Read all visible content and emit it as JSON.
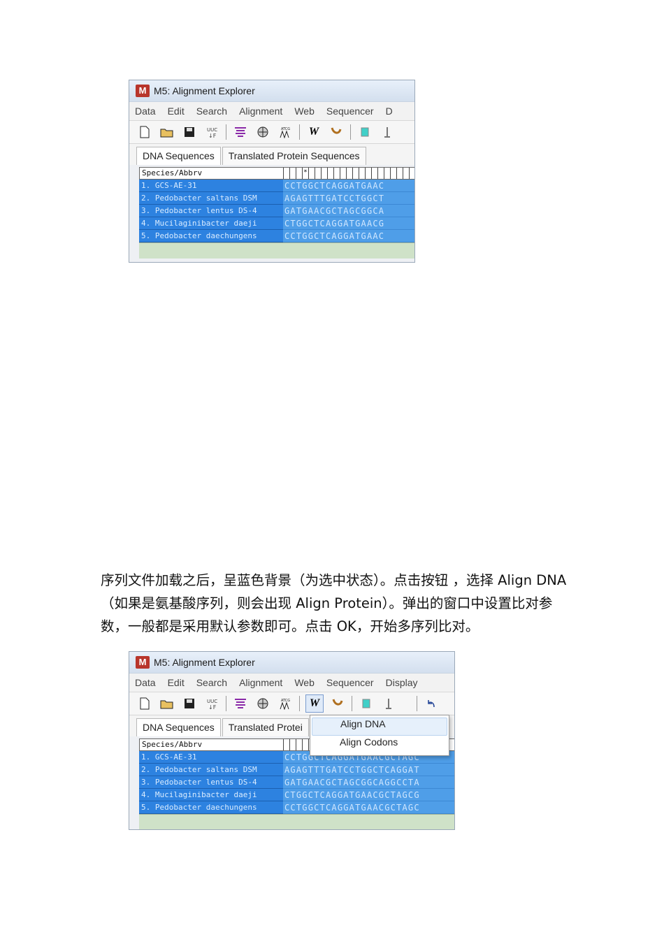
{
  "window1": {
    "title": "M5: Alignment Explorer",
    "menu": [
      "Data",
      "Edit",
      "Search",
      "Alignment",
      "Web",
      "Sequencer",
      "D"
    ],
    "tabs": [
      "DNA Sequences",
      "Translated Protein Sequences"
    ],
    "grid": {
      "header": "Species/Abbrv",
      "header_marker": "*",
      "rows": [
        {
          "name": "1. GCS-AE-31",
          "seq": "CCTGGCTCAGGATGAAC"
        },
        {
          "name": "2. Pedobacter saltans DSM",
          "seq": "AGAGTTTGATCCTGGCT"
        },
        {
          "name": "3. Pedobacter lentus DS-4",
          "seq": "GATGAACGCTAGCGGCA"
        },
        {
          "name": "4. Mucilaginibacter daeji",
          "seq": "CTGGCTCAGGATGAACG"
        },
        {
          "name": "5. Pedobacter daechungens",
          "seq": "CCTGGCTCAGGATGAAC"
        }
      ]
    }
  },
  "paragraph": "序列文件加载之后，呈蓝色背景（为选中状态）。点击按钮 ，选择 Align DNA（如果是氨基酸序列，则会出现 Align Protein）。弹出的窗口中设置比对参数，一般都是采用默认参数即可。点击 OK，开始多序列比对。",
  "window2": {
    "title": "M5: Alignment Explorer",
    "menu": [
      "Data",
      "Edit",
      "Search",
      "Alignment",
      "Web",
      "Sequencer",
      "Display"
    ],
    "tabs": [
      "DNA Sequences",
      "Translated Protei"
    ],
    "popup": [
      "Align DNA",
      "Align Codons"
    ],
    "grid": {
      "header": "Species/Abbrv",
      "rows": [
        {
          "name": "1. GCS-AE-31",
          "seq": "CCTGGCTCAGGATGAACGCTAGC"
        },
        {
          "name": "2. Pedobacter saltans DSM",
          "seq": "AGAGTTTGATCCTGGCTCAGGAT"
        },
        {
          "name": "3. Pedobacter lentus DS-4",
          "seq": "GATGAACGCTAGCGGCAGGCCTA"
        },
        {
          "name": "4. Mucilaginibacter daeji",
          "seq": "CTGGCTCAGGATGAACGCTAGCG"
        },
        {
          "name": "5. Pedobacter daechungens",
          "seq": "CCTGGCTCAGGATGAACGCTAGC"
        }
      ]
    }
  }
}
